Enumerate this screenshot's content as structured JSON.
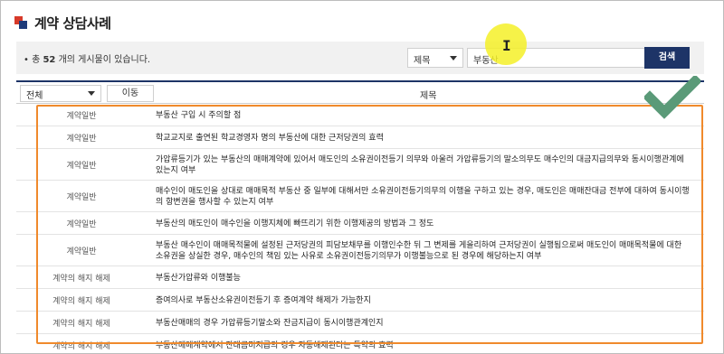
{
  "page": {
    "title": "계약 상담사례"
  },
  "search": {
    "count_prefix": "• 총 ",
    "count": "52",
    "count_suffix": " 개의 게시물이 있습니다.",
    "field_selected": "제목",
    "query": "부동산",
    "button_label": "검색"
  },
  "table": {
    "category_selected": "전체",
    "move_label": "이동",
    "col_title": "제목",
    "rows": [
      {
        "category": "계약일반",
        "title": "부동산 구입 시 주의할 점"
      },
      {
        "category": "계약일반",
        "title": "학교교지로 출연된 학교경영자 명의 부동산에 대한 근저당권의 효력"
      },
      {
        "category": "계약일반",
        "title": "가압류등기가 있는 부동산의 매매계약에 있어서 매도인의 소유권이전등기 의무와 아울러 가압류등기의 말소의무도 매수인의 대금지급의무와 동시이행관계에 있는지 여부"
      },
      {
        "category": "계약일반",
        "title": "매수인이 매도인을 상대로 매매목적 부동산 중 일부에 대해서만 소유권이전등기의무의 이행을 구하고 있는 경우, 매도인은 매매잔대금 전부에 대하여 동시이행의 항변권을 행사할 수 있는지 여부"
      },
      {
        "category": "계약일반",
        "title": "부동산의 매도인이 매수인을 이행지체에 빠뜨리기 위한 이행제공의 방법과 그 정도"
      },
      {
        "category": "계약일반",
        "title": "부동산 매수인이 매매목적물에 설정된 근저당권의 피담보채무를 이행인수한 뒤 그 변제를 게을리하여 근저당권이 실행됨으로써 매도인이 매매목적물에 대한 소유권을 상실한 경우, 매수인의 책임 있는 사유로 소유권이전등기의무가 이행불능으로 된 경우에 해당하는지 여부"
      },
      {
        "category": "계약의 해지 해제",
        "title": "부동산가압류와 이행불능"
      },
      {
        "category": "계약의 해지 해제",
        "title": "증여의사로 부동산소유권이전등기 후 증여계약 해제가 가능한지"
      },
      {
        "category": "계약의 해지 해제",
        "title": "부동산매매의 경우 가압류등기말소와 잔금지급이 동시이행관계인지"
      },
      {
        "category": "계약의 해지 해제",
        "title": "부동산매매계약에서 잔대금미지급의 경우 자동해제된다는 특약의 효력"
      }
    ]
  },
  "colors": {
    "accent_navy": "#1d3467",
    "annotation_orange": "#f08a2c",
    "checkmark_green": "#5a9a78",
    "highlight_yellow": "#f5f028"
  },
  "icons": {
    "title_mark": "square-logo-icon",
    "cursor": "text-cursor-icon",
    "check": "check-mark-icon"
  }
}
